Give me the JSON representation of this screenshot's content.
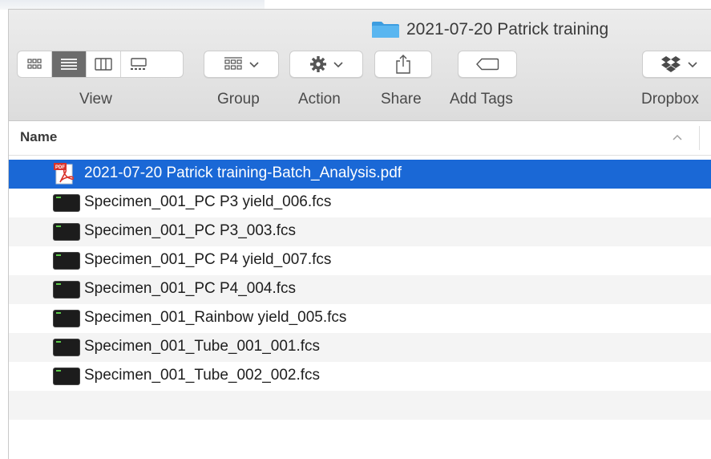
{
  "window": {
    "title": "2021-07-20 Patrick training"
  },
  "toolbar": {
    "view_label": "View",
    "group_label": "Group",
    "action_label": "Action",
    "share_label": "Share",
    "add_tags_label": "Add Tags",
    "dropbox_label": "Dropbox",
    "view_modes": [
      "icon-view-icon",
      "list-view-icon",
      "column-view-icon",
      "gallery-view-icon"
    ],
    "active_view": "list-view-icon"
  },
  "list_header": {
    "name_column": "Name",
    "sort_indicator": "^"
  },
  "files": [
    {
      "name": "2021-07-20 Patrick training-Batch_Analysis.pdf",
      "type": "pdf",
      "selected": true
    },
    {
      "name": "Specimen_001_PC P3 yield_006.fcs",
      "type": "fcs",
      "selected": false
    },
    {
      "name": "Specimen_001_PC P3_003.fcs",
      "type": "fcs",
      "selected": false
    },
    {
      "name": "Specimen_001_PC P4 yield_007.fcs",
      "type": "fcs",
      "selected": false
    },
    {
      "name": "Specimen_001_PC P4_004.fcs",
      "type": "fcs",
      "selected": false
    },
    {
      "name": "Specimen_001_Rainbow yield_005.fcs",
      "type": "fcs",
      "selected": false
    },
    {
      "name": "Specimen_001_Tube_001_001.fcs",
      "type": "fcs",
      "selected": false
    },
    {
      "name": "Specimen_001_Tube_002_002.fcs",
      "type": "fcs",
      "selected": false
    }
  ],
  "colors": {
    "selection": "#1a68d6",
    "folder": "#4aa8e8",
    "pdf_red": "#e0302a"
  }
}
